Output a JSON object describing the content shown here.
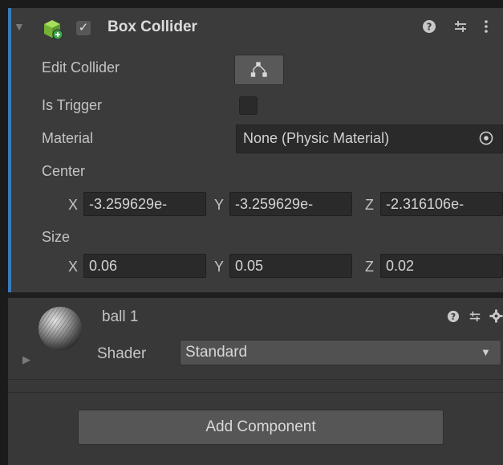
{
  "component": {
    "title": "Box Collider",
    "enabled_check": "✓",
    "fold_icon": "triangle-down-icon",
    "help_icon": "?",
    "presets_icon": "⇆",
    "menu_icon": "⋮"
  },
  "fields": {
    "edit_collider_label": "Edit Collider",
    "is_trigger_label": "Is Trigger",
    "material_label": "Material",
    "material_value": "None (Physic Material)",
    "center_label": "Center",
    "center": {
      "x_label": "X",
      "x": "-3.259629e-",
      "y_label": "Y",
      "y": "-3.259629e-",
      "z_label": "Z",
      "z": "-2.316106e-"
    },
    "size_label": "Size",
    "size": {
      "x_label": "X",
      "x": "0.06",
      "y_label": "Y",
      "y": "0.05",
      "z_label": "Z",
      "z": "0.02"
    }
  },
  "material": {
    "name": "ball 1",
    "shader_label": "Shader",
    "shader_value": "Standard"
  },
  "add_component_label": "Add Component",
  "colors": {
    "background": "#383838",
    "selection_accent": "#3a79bb",
    "field_bg": "#2a2a2a",
    "button_bg": "#565656"
  }
}
